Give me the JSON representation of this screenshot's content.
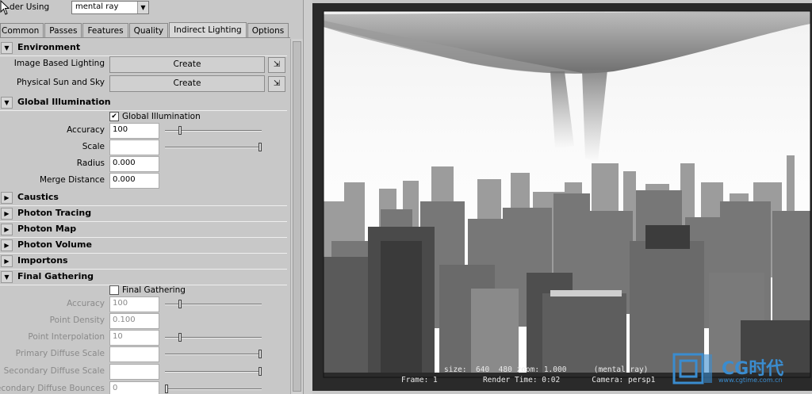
{
  "render_using": {
    "label": "der Using",
    "value": "mental ray"
  },
  "tabs": [
    {
      "label": "Common",
      "active": false
    },
    {
      "label": "Passes",
      "active": false
    },
    {
      "label": "Features",
      "active": false
    },
    {
      "label": "Quality",
      "active": false
    },
    {
      "label": "Indirect Lighting",
      "active": true
    },
    {
      "label": "Options",
      "active": false
    }
  ],
  "environment": {
    "title": "Environment",
    "image_based_lighting": {
      "label": "Image Based Lighting",
      "button": "Create"
    },
    "physical_sun_sky": {
      "label": "Physical Sun and Sky",
      "button": "Create"
    }
  },
  "global_illumination": {
    "title": "Global Illumination",
    "checkbox_label": "Global Illumination",
    "checked": true,
    "accuracy": {
      "label": "Accuracy",
      "value": "100",
      "slider": 0.14
    },
    "scale": {
      "label": "Scale",
      "value": "",
      "slider": 1.0
    },
    "radius": {
      "label": "Radius",
      "value": "0.000"
    },
    "merge_distance": {
      "label": "Merge Distance",
      "value": "0.000"
    }
  },
  "collapsed_sections": [
    "Caustics",
    "Photon Tracing",
    "Photon Map",
    "Photon Volume",
    "Importons"
  ],
  "final_gathering": {
    "title": "Final Gathering",
    "checkbox_label": "Final Gathering",
    "checked": false,
    "accuracy": {
      "label": "Accuracy",
      "value": "100",
      "slider": 0.14
    },
    "point_density": {
      "label": "Point Density",
      "value": "0.100"
    },
    "point_interpolation": {
      "label": "Point Interpolation",
      "value": "10",
      "slider": 0.14
    },
    "primary_diffuse_scale": {
      "label": "Primary Diffuse Scale",
      "value": "",
      "slider": 1.0
    },
    "secondary_diffuse_scale": {
      "label": "Secondary Diffuse Scale",
      "value": "",
      "slider": 1.0
    },
    "secondary_diffuse_bounces": {
      "label": "Secondary Diffuse Bounces",
      "value": "0",
      "slider": 0.0
    }
  },
  "render_stats": {
    "line1": "size:  640  480 zoom: 1.000      (mental ray)",
    "line2": "Frame: 1          Render Time: 0:02       Camera: persp1"
  },
  "watermark": {
    "text": "CG时代",
    "url": "www.cgtime.com.cn"
  },
  "colors": {
    "panel_bg": "#c8c8c8",
    "watermark": "#3a8ccf",
    "render_bg": "#2a2a2a"
  }
}
